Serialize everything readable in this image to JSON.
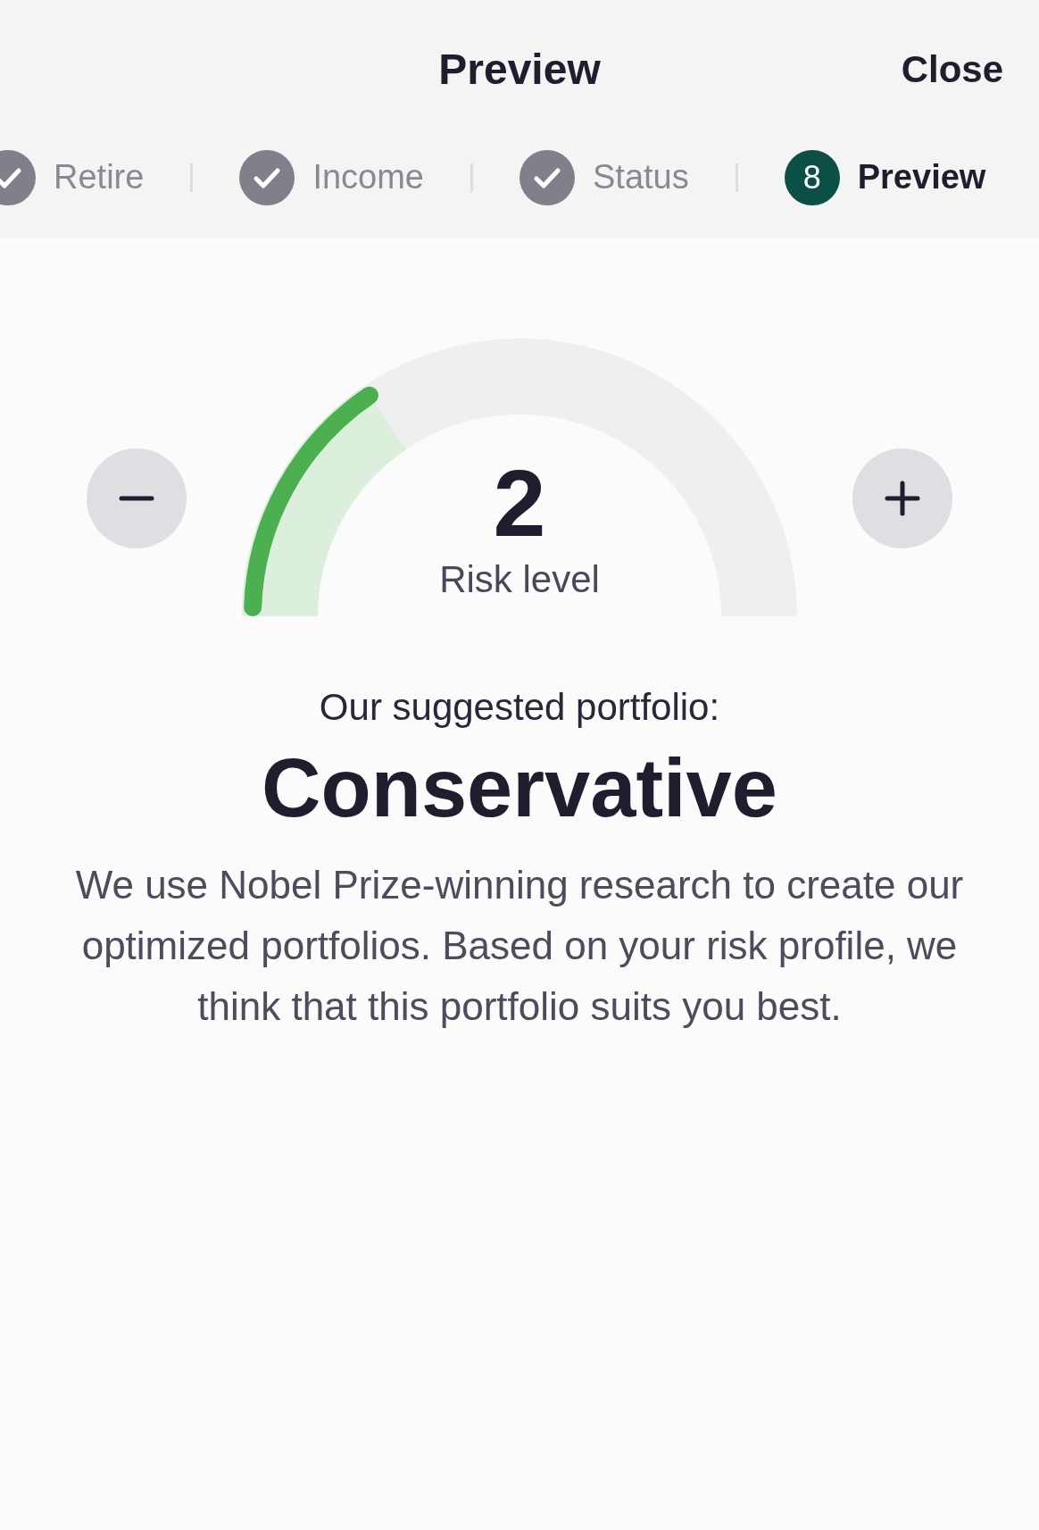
{
  "header": {
    "title": "Preview",
    "close": "Close"
  },
  "steps": [
    {
      "label": "Retire",
      "completed": true,
      "selected": false
    },
    {
      "label": "Income",
      "completed": true,
      "selected": false
    },
    {
      "label": "Status",
      "completed": true,
      "selected": false
    },
    {
      "label": "Preview",
      "number": "8",
      "completed": false,
      "selected": true
    }
  ],
  "gauge": {
    "value": "2",
    "label": "Risk level",
    "level": 0.31
  },
  "result": {
    "intro": "Our suggested portfolio:",
    "portfolio": "Conservative",
    "description": "We use Nobel Prize-winning research to create our optimized portfolios. Based on your risk profile, we think that this portfolio suits you best."
  }
}
